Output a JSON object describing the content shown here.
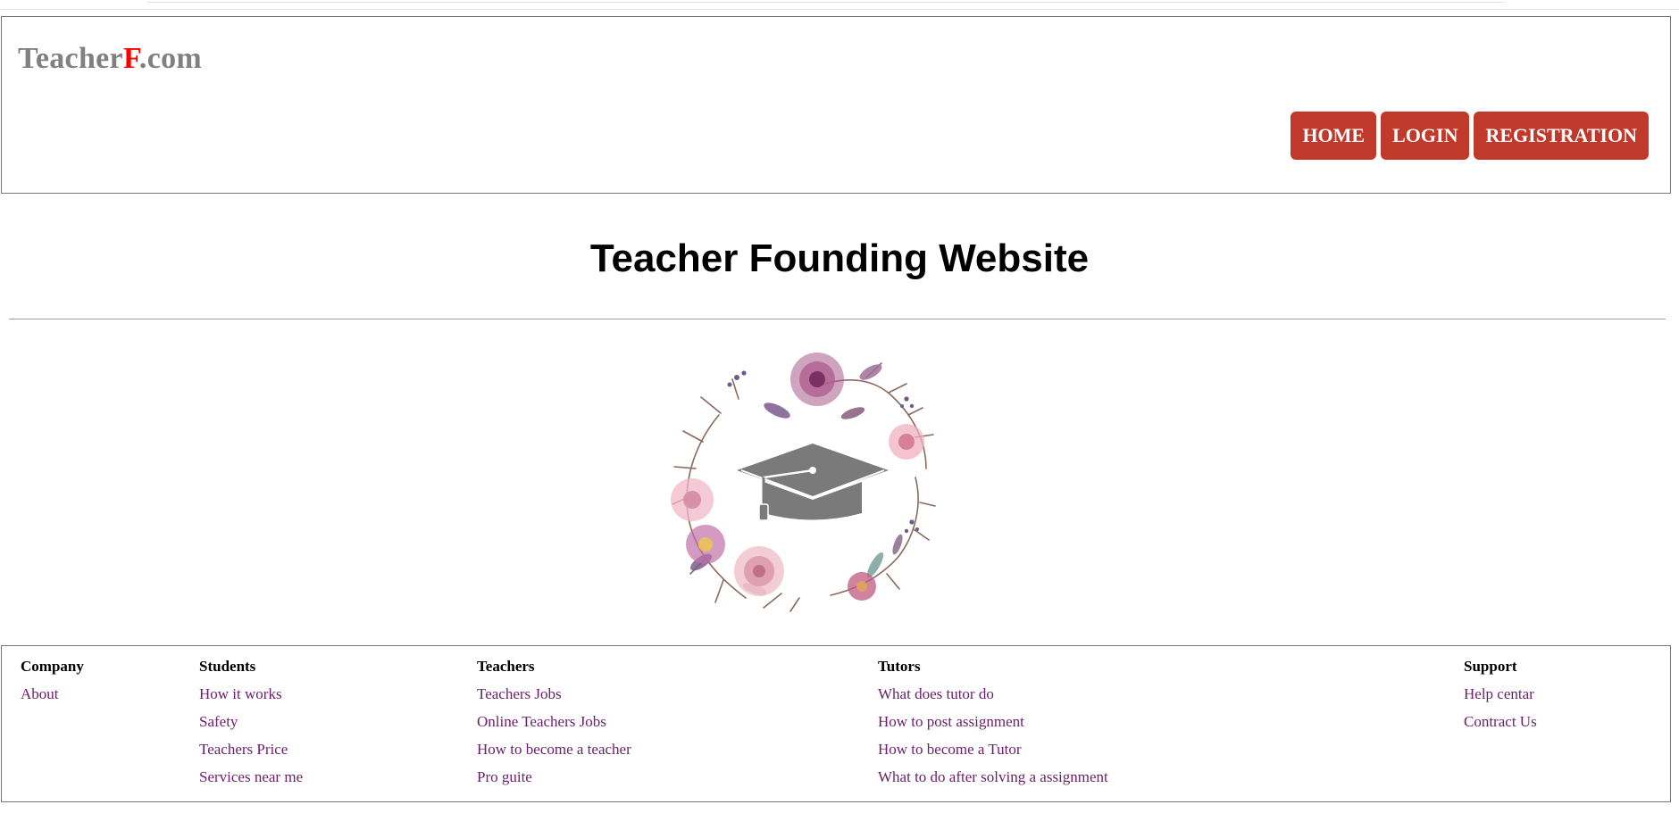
{
  "logo": {
    "main": "Teacher",
    "accent": "F",
    "suffix": ".com"
  },
  "nav": {
    "home": "HOME",
    "login": "LOGIN",
    "registration": "REGISTRATION"
  },
  "page_title": "Teacher Founding Website",
  "colors": {
    "button": "#c0392b",
    "logo_gray": "#808080",
    "logo_accent": "#ff0000",
    "link": "#6b1e6b"
  },
  "hero_image": {
    "icon": "graduation-cap-icon",
    "decoration": "floral-wreath"
  },
  "footer": {
    "company": {
      "heading": "Company",
      "links": [
        "About"
      ]
    },
    "students": {
      "heading": "Students",
      "links": [
        "How it works",
        "Safety",
        "Teachers Price",
        "Services near me"
      ]
    },
    "teachers": {
      "heading": "Teachers",
      "links": [
        "Teachers Jobs",
        "Online Teachers Jobs",
        "How to become a teacher",
        "Pro guite"
      ]
    },
    "tutors": {
      "heading": "Tutors",
      "links": [
        "What does tutor do",
        "How to post assignment",
        "How to become a Tutor",
        "What to do after solving a assignment"
      ]
    },
    "support": {
      "heading": "Support",
      "links": [
        "Help centar",
        "Contract Us"
      ]
    }
  }
}
